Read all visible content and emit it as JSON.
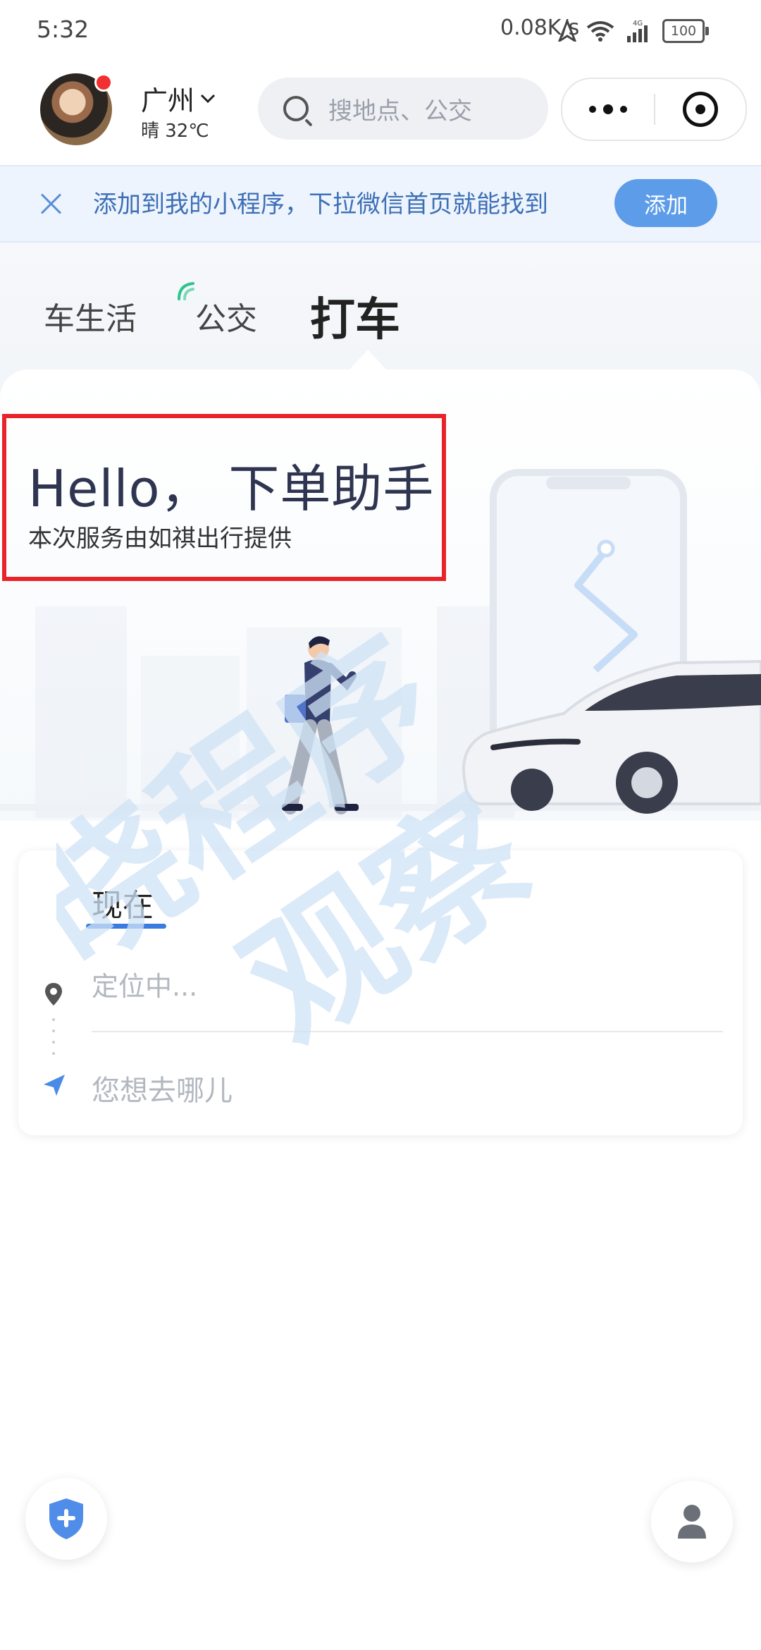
{
  "status_bar": {
    "time": "5:32",
    "net_speed": "0.08K/s",
    "network": "4G",
    "battery": "100"
  },
  "header": {
    "city": "广州",
    "weather": "晴 32℃",
    "search_placeholder": "搜地点、公交"
  },
  "banner": {
    "text": "添加到我的小程序，下拉微信首页就能找到",
    "button": "添加"
  },
  "tabs": [
    {
      "label": "车生活"
    },
    {
      "label": "公交"
    },
    {
      "label": "打车",
      "active": true
    }
  ],
  "hero": {
    "title": "Hello， 下单助手",
    "subtitle": "本次服务由如祺出行提供"
  },
  "watermark": [
    "晓程序",
    "观察"
  ],
  "route": {
    "time_label": "现在",
    "from_placeholder": "定位中...",
    "to_placeholder": "您想去哪儿"
  },
  "colors": {
    "accent": "#3a7be0",
    "banner_bg": "#edf4fd",
    "banner_button": "#5d9ce9",
    "highlight_box": "#e8232a"
  }
}
